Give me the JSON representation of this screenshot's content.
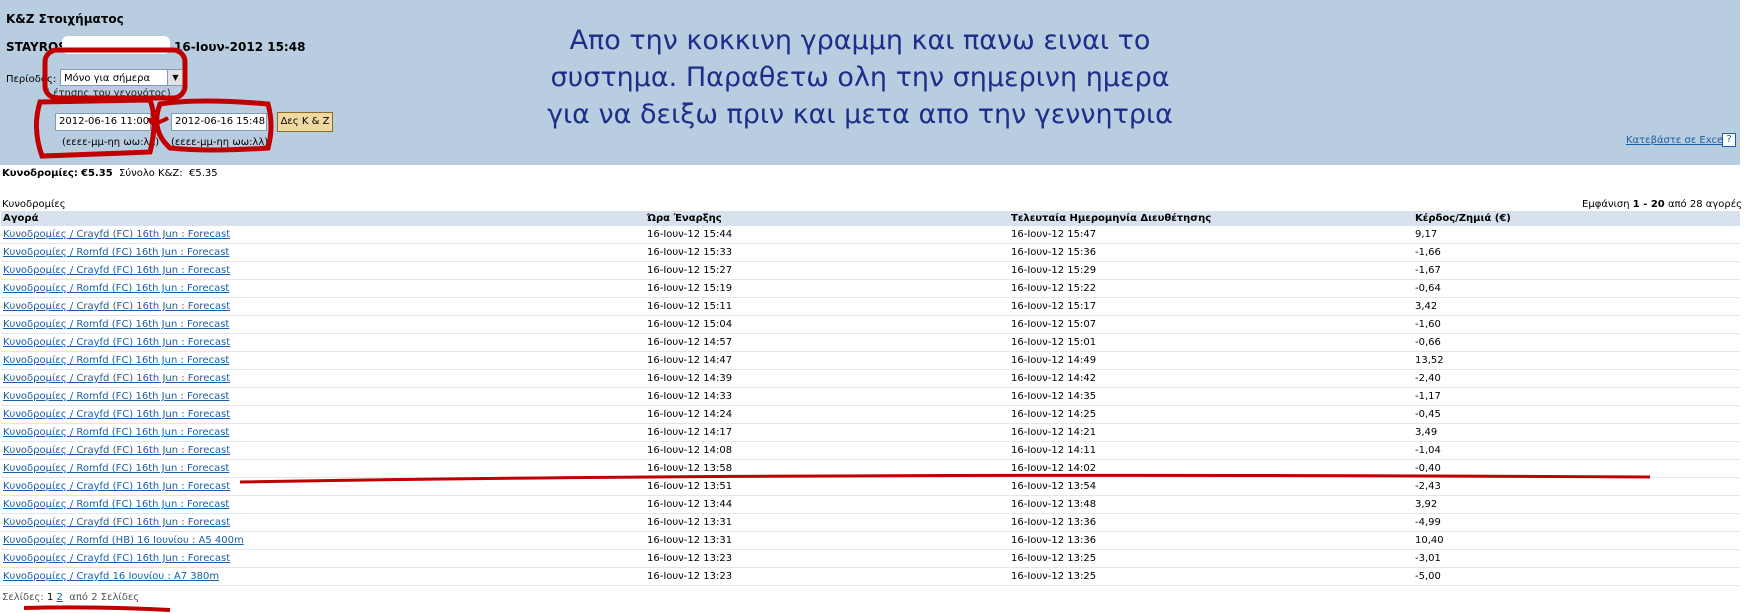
{
  "header": {
    "title": "K&Z Στοιχήματος",
    "user": "STAYROS",
    "datetime": "16-Ιουν-2012 15:48",
    "period_label": "Περίοδος:",
    "period_value": "Μόνο για σήμερα",
    "period_hint": "(                                     έτησης του γεγονότος)",
    "date_from": "2012-06-16 11:00",
    "date_separator": "-",
    "date_to": "2012-06-16 15:48",
    "show_button": "Δες K & Z",
    "format_hint_from": "(εεεε-μμ-ηη ωω:λλ)",
    "format_hint_to": "(εεεε-μμ-ηη ωω:λλ)",
    "excel_link": "Κατεβάστε σε Excel",
    "help_icon_text": "?"
  },
  "annotation": {
    "lines": [
      "Απο την κοκκινη γραμμη και πανω ειναι το",
      "συστημα. Παραθετω ολη την σημερινη ημερα",
      "για να δειξω πριν και  μετα απο την γεννητρια"
    ]
  },
  "summary": {
    "label": "Κυνοδρομίες:",
    "amount": "€5.35",
    "total_label": "Σύνολο K&Z:",
    "total_amount": "€5.35"
  },
  "section_label": "Κυνοδρομίες",
  "showing": {
    "prefix": "Εμφάνιση",
    "range": "1 - 20",
    "suffix": "από 28 αγορές"
  },
  "table": {
    "headers": [
      "Αγορά",
      "Ώρα Έναρξης",
      "Τελευταία Ημερομηνία Διευθέτησης",
      "Κέρδος/Ζημιά (€)"
    ],
    "rows": [
      {
        "market": "Κυνοδρομίες / Crayfd (FC) 16th Jun : Forecast",
        "start": "16-Ιουν-12 15:44",
        "settled": "16-Ιουν-12 15:47",
        "pl": "9,17"
      },
      {
        "market": "Κυνοδρομίες / Romfd (FC) 16th Jun : Forecast",
        "start": "16-Ιουν-12 15:33",
        "settled": "16-Ιουν-12 15:36",
        "pl": "-1,66"
      },
      {
        "market": "Κυνοδρομίες / Crayfd (FC) 16th Jun : Forecast",
        "start": "16-Ιουν-12 15:27",
        "settled": "16-Ιουν-12 15:29",
        "pl": "-1,67"
      },
      {
        "market": "Κυνοδρομίες / Romfd (FC) 16th Jun : Forecast",
        "start": "16-Ιουν-12 15:19",
        "settled": "16-Ιουν-12 15:22",
        "pl": "-0,64"
      },
      {
        "market": "Κυνοδρομίες / Crayfd (FC) 16th Jun : Forecast",
        "start": "16-Ιουν-12 15:11",
        "settled": "16-Ιουν-12 15:17",
        "pl": "3,42"
      },
      {
        "market": "Κυνοδρομίες / Romfd (FC) 16th Jun : Forecast",
        "start": "16-Ιουν-12 15:04",
        "settled": "16-Ιουν-12 15:07",
        "pl": "-1,60"
      },
      {
        "market": "Κυνοδρομίες / Crayfd (FC) 16th Jun : Forecast",
        "start": "16-Ιουν-12 14:57",
        "settled": "16-Ιουν-12 15:01",
        "pl": "-0,66"
      },
      {
        "market": "Κυνοδρομίες / Romfd (FC) 16th Jun : Forecast",
        "start": "16-Ιουν-12 14:47",
        "settled": "16-Ιουν-12 14:49",
        "pl": "13,52"
      },
      {
        "market": "Κυνοδρομίες / Crayfd (FC) 16th Jun : Forecast",
        "start": "16-Ιουν-12 14:39",
        "settled": "16-Ιουν-12 14:42",
        "pl": "-2,40"
      },
      {
        "market": "Κυνοδρομίες / Romfd (FC) 16th Jun : Forecast",
        "start": "16-Ιουν-12 14:33",
        "settled": "16-Ιουν-12 14:35",
        "pl": "-1,17"
      },
      {
        "market": "Κυνοδρομίες / Crayfd (FC) 16th Jun : Forecast",
        "start": "16-Ιουν-12 14:24",
        "settled": "16-Ιουν-12 14:25",
        "pl": "-0,45"
      },
      {
        "market": "Κυνοδρομίες / Romfd (FC) 16th Jun : Forecast",
        "start": "16-Ιουν-12 14:17",
        "settled": "16-Ιουν-12 14:21",
        "pl": "3,49"
      },
      {
        "market": "Κυνοδρομίες / Crayfd (FC) 16th Jun : Forecast",
        "start": "16-Ιουν-12 14:08",
        "settled": "16-Ιουν-12 14:11",
        "pl": "-1,04"
      },
      {
        "market": "Κυνοδρομίες / Romfd (FC) 16th Jun : Forecast",
        "start": "16-Ιουν-12 13:58",
        "settled": "16-Ιουν-12 14:02",
        "pl": "-0,40"
      },
      {
        "market": "Κυνοδρομίες / Crayfd (FC) 16th Jun : Forecast",
        "start": "16-Ιουν-12 13:51",
        "settled": "16-Ιουν-12 13:54",
        "pl": "-2,43"
      },
      {
        "market": "Κυνοδρομίες / Romfd (FC) 16th Jun : Forecast",
        "start": "16-Ιουν-12 13:44",
        "settled": "16-Ιουν-12 13:48",
        "pl": "3,92"
      },
      {
        "market": "Κυνοδρομίες / Crayfd (FC) 16th Jun : Forecast",
        "start": "16-Ιουν-12 13:31",
        "settled": "16-Ιουν-12 13:36",
        "pl": "-4,99"
      },
      {
        "market": "Κυνοδρομίες / Romfd (HB) 16 Ιουνίου : A5 400m",
        "start": "16-Ιουν-12 13:31",
        "settled": "16-Ιουν-12 13:36",
        "pl": "10,40"
      },
      {
        "market": "Κυνοδρομίες / Crayfd (FC) 16th Jun : Forecast",
        "start": "16-Ιουν-12 13:23",
        "settled": "16-Ιουν-12 13:25",
        "pl": "-3,01"
      },
      {
        "market": "Κυνοδρομίες / Crayfd 16 Ιουνίου : A7 380m",
        "start": "16-Ιουν-12 13:23",
        "settled": "16-Ιουν-12 13:25",
        "pl": "-5,00"
      }
    ]
  },
  "pager": {
    "label": "Σελίδες:",
    "pages": [
      "1",
      "2"
    ],
    "suffix": "από 2 Σελίδες"
  },
  "colors": {
    "header_bg": "#b9cde0",
    "annotation_text": "#1b2f8a",
    "link": "#1a5ea6",
    "markup_red": "#c00000"
  }
}
